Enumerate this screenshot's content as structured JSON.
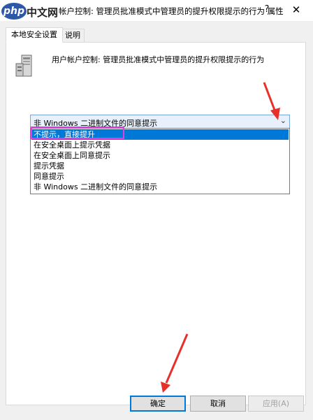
{
  "window": {
    "title": "帐户控制: 管理员批准模式中管理员的提升权限提示的行为 属性",
    "help_label": "?",
    "close_label": "✕"
  },
  "watermark": {
    "brand": "php",
    "text": "中文网"
  },
  "tabs": [
    {
      "label": "本地安全设置",
      "active": true
    },
    {
      "label": "说明",
      "active": false
    }
  ],
  "policy": {
    "icon": "server-icon",
    "name": "用户帐户控制: 管理员批准模式中管理员的提升权限提示的行为"
  },
  "dropdown": {
    "selected_value": "非 Windows 二进制文件的同意提示",
    "options": [
      "不提示，直接提升",
      "在安全桌面上提示凭据",
      "在安全桌面上同意提示",
      "提示凭据",
      "同意提示",
      "非 Windows 二进制文件的同意提示"
    ],
    "highlighted_index": 0
  },
  "buttons": {
    "ok": "确定",
    "cancel": "取消",
    "apply": "应用(A)"
  },
  "colors": {
    "selection": "#0078d7",
    "annotation_box": "#e040e0",
    "annotation_arrow": "#e8302a"
  }
}
